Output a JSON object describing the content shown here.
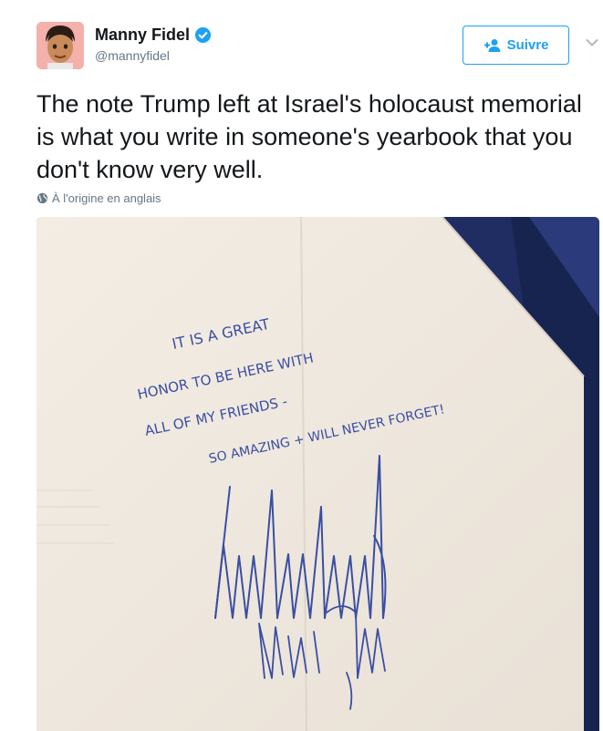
{
  "user": {
    "display_name": "Manny Fidel",
    "handle": "@mannyfidel",
    "verified": true,
    "avatar_icon": "emoji-avatar"
  },
  "actions": {
    "follow_label": "Suivre",
    "follow_icon": "add-user-icon",
    "menu_icon": "chevron-down-icon"
  },
  "tweet": {
    "text": "The note Trump left at Israel's holocaust memorial is what you write in someone's yearbook that you don't know very well.",
    "translation_label": "À l'origine en anglais"
  },
  "media": {
    "note_lines": [
      "IT IS A GREAT",
      "HONOR TO BE HERE WITH",
      "ALL OF MY FRIENDS -",
      "SO AMAZING + WILL NEVER FORGET!"
    ]
  },
  "colors": {
    "accent": "#1da1f2",
    "text": "#14171a",
    "muted": "#657786",
    "ink": "#3a4ea3"
  }
}
